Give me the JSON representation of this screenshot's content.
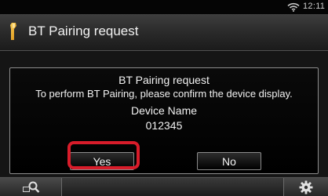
{
  "status_bar": {
    "time": "12:11",
    "wifi_icon": "wifi-icon"
  },
  "title_bar": {
    "icon": "bluetooth-phone-icon",
    "title": "BT Pairing request"
  },
  "dialog": {
    "title": "BT Pairing request",
    "message": "To perform BT Pairing, please confirm the device display.",
    "device_name_label": "Device Name",
    "device_name_value": "012345",
    "yes_label": "Yes",
    "no_label": "No",
    "highlight_color": "#d81c2a"
  },
  "bottom_bar": {
    "left_icon": "search-icon",
    "right_icon": "gear-icon"
  }
}
